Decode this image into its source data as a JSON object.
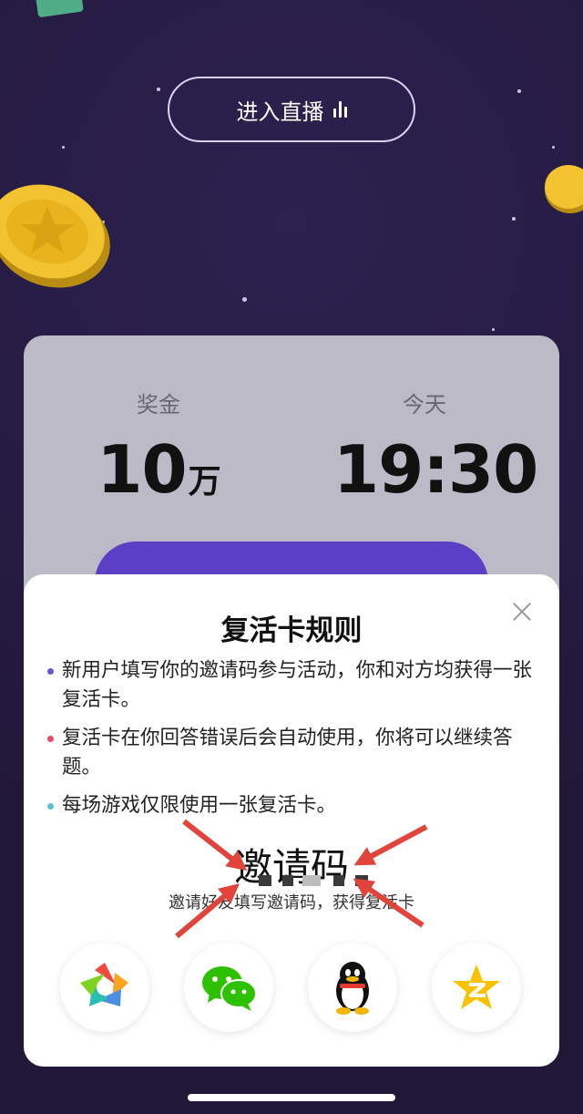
{
  "header": {
    "live_button_label": "进入直播"
  },
  "info_card": {
    "prize_label": "奖金",
    "prize_value": "10",
    "prize_unit": "万",
    "time_label": "今天",
    "time_value": "19:30"
  },
  "modal": {
    "title": "复活卡规则",
    "rules": [
      {
        "text": "新用户填写你的邀请码参与活动，你和对方均获得一张复活卡。",
        "dot_color": "#6c52d4"
      },
      {
        "text": "复活卡在你回答错误后会自动使用，你将可以继续答题。",
        "dot_color": "#e8486b"
      },
      {
        "text": "每场游戏仅限使用一张复活卡。",
        "dot_color": "#56c2d6"
      }
    ],
    "invite_code_title": "邀请码",
    "invite_hint": "邀请好友填写邀请码，获得复活卡",
    "share_targets": [
      {
        "icon": "moments-aperture-icon"
      },
      {
        "icon": "wechat-icon"
      },
      {
        "icon": "qq-penguin-icon"
      },
      {
        "icon": "qzone-star-icon"
      }
    ]
  },
  "colors": {
    "background": "#241a3f",
    "card": "#bdbac7",
    "accent_purple": "#5c3fc7",
    "annotation_arrow": "#e0443a"
  }
}
